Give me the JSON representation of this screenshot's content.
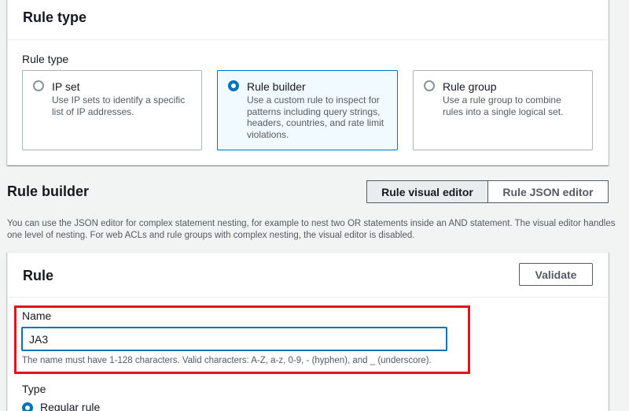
{
  "rule_type_panel": {
    "title": "Rule type",
    "field_label": "Rule type",
    "options": [
      {
        "title": "IP set",
        "desc": "Use IP sets to identify a specific list of IP addresses.",
        "selected": false
      },
      {
        "title": "Rule builder",
        "desc": "Use a custom rule to inspect for patterns including query strings, headers, countries, and rate limit violations.",
        "selected": true
      },
      {
        "title": "Rule group",
        "desc": "Use a rule group to combine rules into a single logical set.",
        "selected": false
      }
    ]
  },
  "rule_builder": {
    "title": "Rule builder",
    "tabs": [
      "Rule visual editor",
      "Rule JSON editor"
    ],
    "active_tab": "Rule visual editor",
    "help": "You can use the JSON editor for complex statement nesting, for example to nest two OR statements inside an AND statement. The visual editor handles one level of nesting. For web ACLs and rule groups with complex nesting, the visual editor is disabled."
  },
  "rule_panel": {
    "title": "Rule",
    "validate_label": "Validate",
    "name_label": "Name",
    "name_value": "JA3",
    "name_help": "The name must have 1-128 characters. Valid characters: A-Z, a-z, 0-9, - (hyphen), and _ (underscore).",
    "type_label": "Type",
    "type_option": "Regular rule"
  },
  "colors": {
    "accent": "#0073bb",
    "highlight": "#e0141e",
    "selected_tile_bg": "#f1faff"
  }
}
